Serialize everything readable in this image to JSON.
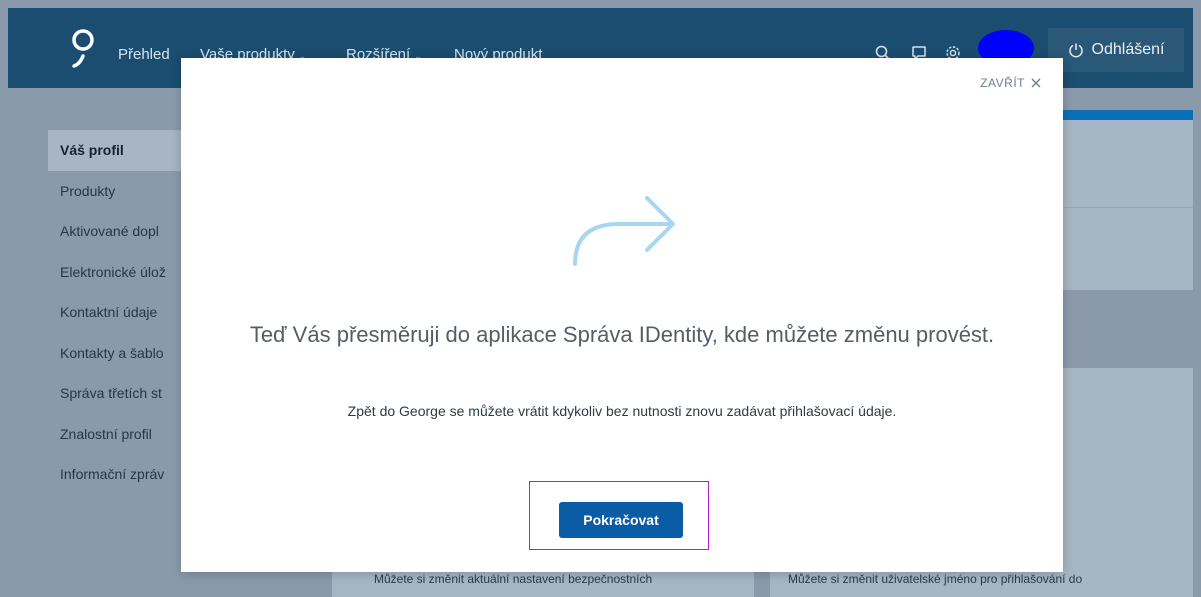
{
  "topnav": {
    "items": [
      {
        "label": "Přehled",
        "dropdown": false
      },
      {
        "label": "Vaše produkty",
        "dropdown": true
      },
      {
        "label": "Rozšíření",
        "dropdown": true
      },
      {
        "label": "Nový produkt",
        "dropdown": false
      }
    ],
    "icons": [
      "search-icon",
      "chat-icon",
      "settings-icon"
    ],
    "logout_label": "Odhlášení",
    "avatar_color": "#0000ff"
  },
  "sidebar": {
    "items": [
      {
        "label": "Váš profil",
        "active": true
      },
      {
        "label": "Produkty"
      },
      {
        "label": "Aktivované dopl"
      },
      {
        "label": "Elektronické úlož"
      },
      {
        "label": "Kontaktní údaje"
      },
      {
        "label": "Kontakty a šablo"
      },
      {
        "label": "Správa třetích st"
      },
      {
        "label": "Znalostní profil"
      },
      {
        "label": "Informační zpráv"
      }
    ]
  },
  "background": {
    "card_left_text": "Můžete si změnit aktuální nastavení bezpečnostních",
    "card_right_text": "Můžete si změnit uživatelské jméno pro přihlašování do"
  },
  "modal": {
    "close_label": "ZAVŘÍT",
    "headline": "Teď Vás přesměruji do aplikace Správa IDentity, kde můžete změnu provést.",
    "subtext": "Zpět do George se můžete vrátit kdykoliv bez nutnosti znovu zadávat přihlašovací údaje.",
    "continue_label": "Pokračovat",
    "accent_color": "#0b5ca6",
    "highlight_color": "#b020c8"
  }
}
